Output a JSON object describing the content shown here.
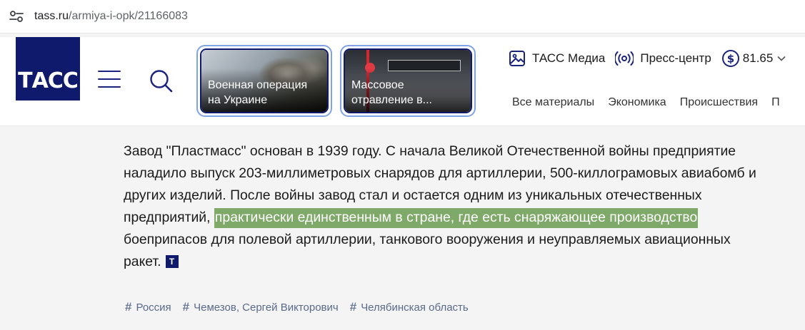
{
  "browser": {
    "url_host": "tass.ru",
    "url_path": "/armiya-i-opk/21166083"
  },
  "header": {
    "logo_text": "ТАСС",
    "cards": [
      {
        "title": "Военная операция на Украине"
      },
      {
        "title": "Массовое отравление в..."
      }
    ],
    "top_links": {
      "media": "ТАСС Медиа",
      "press": "Пресс-центр",
      "rate": "81.65"
    },
    "nav": [
      "Все материалы",
      "Экономика",
      "Происшествия",
      "П"
    ]
  },
  "article": {
    "text_before": "Завод \"Пластмасс\" основан в 1939 году. С начала Великой Отечественной войны предприятие наладило выпуск 203-миллиметровых снарядов для артиллерии, 500-киллограмовых авиабомб и других изделий. После войны завод стал и остается одним из уникальных отечественных предприятий, ",
    "text_highlight": "практически единственным в стране, где есть снаряжающее производство",
    "text_after": " боеприпасов для полевой артиллерии, танкового вооружения и неуправляемых авиационных ракет.",
    "badge": "Т"
  },
  "tags": [
    "Россия",
    "Чемезов, Сергей Викторович",
    "Челябинская область"
  ],
  "colors": {
    "brand": "#0f1a6c",
    "highlight": "#7fa968",
    "card_border": "#7fa3e6",
    "tag": "#5a6a8a"
  },
  "icons": {
    "site_info": "tune-icon",
    "menu": "hamburger-icon",
    "search": "search-icon",
    "media": "image-icon",
    "press": "broadcast-icon",
    "rate": "dollar-circle-icon",
    "rate_toggle": "chevron-down-icon"
  }
}
